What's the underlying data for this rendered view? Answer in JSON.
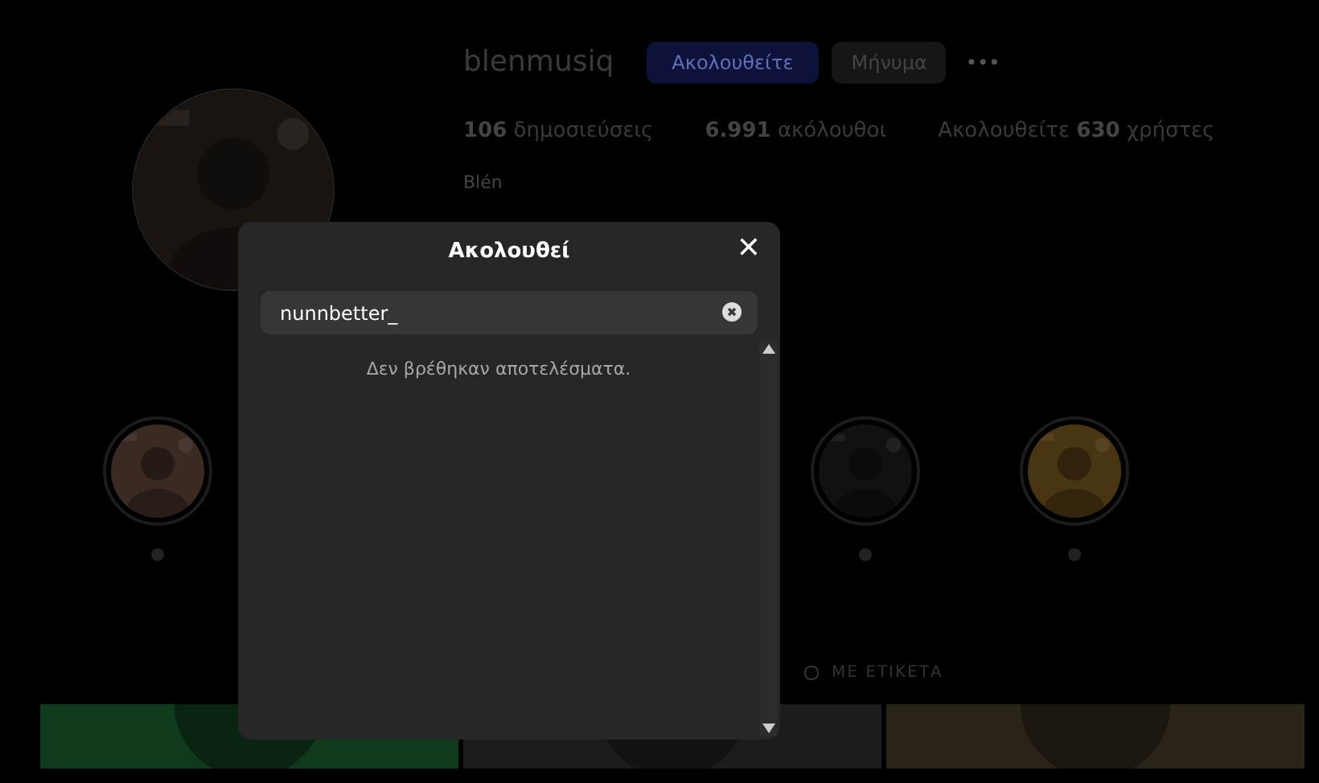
{
  "profile": {
    "username": "blenmusiq",
    "follow_button": "Ακολουθείτε",
    "message_button": "Μήνυμα",
    "more": "•••",
    "stats": [
      {
        "count": "106",
        "label": "δημοσιεύσεις"
      },
      {
        "count": "6.991",
        "label": "ακόλουθοι"
      },
      {
        "prefix": "Ακολουθείτε",
        "count": "630",
        "label": "χρήστες"
      }
    ],
    "bio_name": "Blén"
  },
  "tagged_tab": "ΜΕ ΕΤΙΚΕΤΑ",
  "modal": {
    "title": "Ακολουθεί",
    "close": "✕",
    "search": {
      "value": "nunnbetter_"
    },
    "empty_message": "Δεν βρέθηκαν αποτελέσματα."
  }
}
